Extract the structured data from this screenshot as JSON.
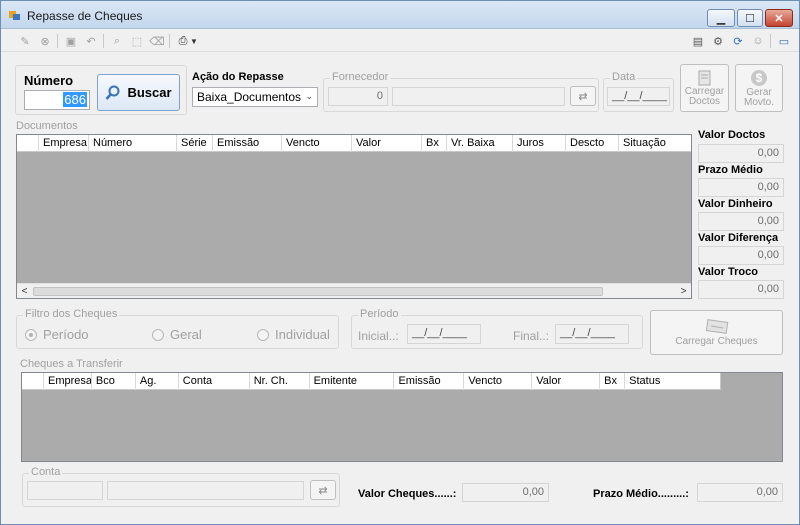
{
  "window": {
    "title": "Repasse de Cheques",
    "minimize_label": "▁",
    "maximize_label": "☐",
    "close_label": "✕"
  },
  "search": {
    "numero_label": "Número",
    "numero_value": "686",
    "buscar_label": "Buscar"
  },
  "acao": {
    "label": "Ação do Repasse",
    "selected": "Baixa_Documentos"
  },
  "fornecedor": {
    "label": "Fornecedor",
    "code": "0",
    "name": ""
  },
  "data": {
    "label": "Data",
    "value": "__/__/____"
  },
  "actions": {
    "carregar_doctos": "Carregar\nDoctos",
    "gerar_movto": "Gerar\nMovto.",
    "carregar_cheques": "Carregar Cheques"
  },
  "documentos": {
    "label": "Documentos",
    "columns": [
      "Empresa",
      "Número",
      "Série",
      "Emissão",
      "Vencto",
      "Valor",
      "Bx",
      "Vr. Baixa",
      "Juros",
      "Descto",
      "Situação"
    ]
  },
  "totals_side": {
    "valor_doctos_label": "Valor Doctos",
    "valor_doctos": "0,00",
    "prazo_medio_label": "Prazo Médio",
    "prazo_medio": "0,00",
    "valor_dinheiro_label": "Valor Dinheiro",
    "valor_dinheiro": "0,00",
    "valor_diferenca_label": "Valor Diferença",
    "valor_diferenca": "0,00",
    "valor_troco_label": "Valor Troco",
    "valor_troco": "0,00"
  },
  "filtro": {
    "label": "Filtro dos Cheques",
    "options": [
      "Período",
      "Geral",
      "Individual"
    ],
    "selected": "Período"
  },
  "periodo": {
    "label": "Período",
    "inicial_label": "Inicial..:",
    "inicial_value": "__/__/____",
    "final_label": "Final..:",
    "final_value": "__/__/____"
  },
  "cheques": {
    "label": "Cheques a Transferir",
    "columns": [
      "Empresa",
      "Bco",
      "Ag.",
      "Conta",
      "Nr. Ch.",
      "Emitente",
      "Emissão",
      "Vencto",
      "Valor",
      "Bx",
      "Status"
    ]
  },
  "conta": {
    "label": "Conta"
  },
  "footer": {
    "valor_cheques_label": "Valor Cheques......:",
    "valor_cheques": "0,00",
    "prazo_medio_label": "Prazo Médio.........:",
    "prazo_medio": "0,00"
  }
}
